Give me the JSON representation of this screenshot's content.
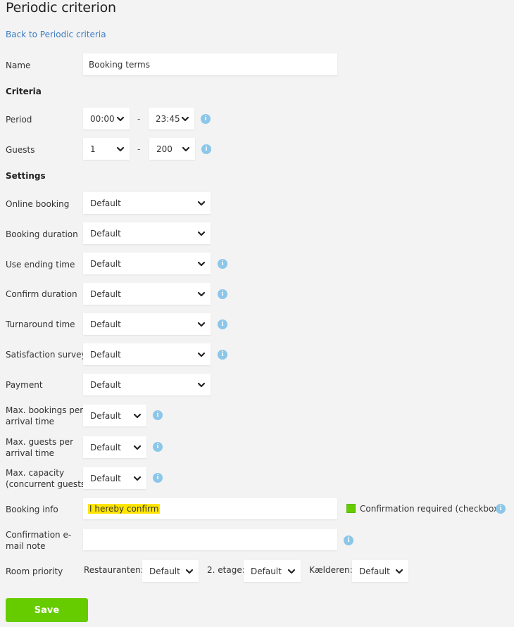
{
  "page": {
    "title": "Periodic criterion",
    "back_link": "Back to Periodic criteria"
  },
  "name_field": {
    "label": "Name",
    "value": "Booking terms"
  },
  "criteria": {
    "heading": "Criteria",
    "period": {
      "label": "Period",
      "from": "00:00",
      "separator": "-",
      "to": "23:45"
    },
    "guests": {
      "label": "Guests",
      "from": "1",
      "separator": "-",
      "to": "200"
    }
  },
  "settings": {
    "heading": "Settings",
    "online_booking": {
      "label": "Online booking",
      "value": "Default"
    },
    "booking_duration": {
      "label": "Booking duration",
      "value": "Default"
    },
    "use_ending_time": {
      "label": "Use ending time",
      "value": "Default"
    },
    "confirm_duration": {
      "label": "Confirm duration",
      "value": "Default"
    },
    "turnaround_time": {
      "label": "Turnaround time",
      "value": "Default"
    },
    "satisfaction_surveys": {
      "label": "Satisfaction surveys",
      "value": "Default"
    },
    "payment": {
      "label": "Payment",
      "value": "Default"
    },
    "max_bookings": {
      "label_line1": "Max. bookings per",
      "label_line2": "arrival time",
      "value": "Default"
    },
    "max_guests": {
      "label_line1": "Max. guests per",
      "label_line2": "arrival time",
      "value": "Default"
    },
    "max_capacity": {
      "label_line1": "Max. capacity",
      "label_line2": "(concurrent guests)",
      "value": "Default"
    },
    "booking_info": {
      "label": "Booking info",
      "value": "I hereby confirm",
      "checkbox_label": "Confirmation required (checkbox)",
      "checkbox_checked": true
    },
    "confirmation_note": {
      "label_line1": "Confirmation e-",
      "label_line2": "mail note",
      "value": ""
    },
    "room_priority": {
      "label": "Room priority",
      "rooms": [
        {
          "name": "Restauranten:",
          "value": "Default"
        },
        {
          "name": "2. etage:",
          "value": "Default"
        },
        {
          "name": "Kælderen:",
          "value": "Default"
        }
      ]
    }
  },
  "actions": {
    "save_label": "Save"
  },
  "colors": {
    "accent_green": "#66cc00",
    "info_blue": "#8cc6e8",
    "link_blue": "#3a7cc4",
    "highlight": "#ffe600"
  }
}
